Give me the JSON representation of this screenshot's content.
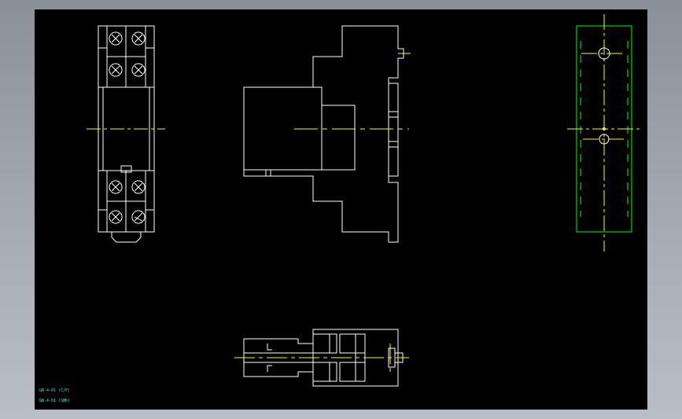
{
  "colors": {
    "background": "#000000",
    "outline": "#ffffff",
    "centerline": "#ffff00",
    "side_view": "#00ff00",
    "annotation": "#00ffff",
    "frame": "#9aa0a8"
  },
  "annotations": {
    "line_1": "GB-4-01 (C/P)",
    "line_2": "GB-4-01 (SHK)"
  }
}
